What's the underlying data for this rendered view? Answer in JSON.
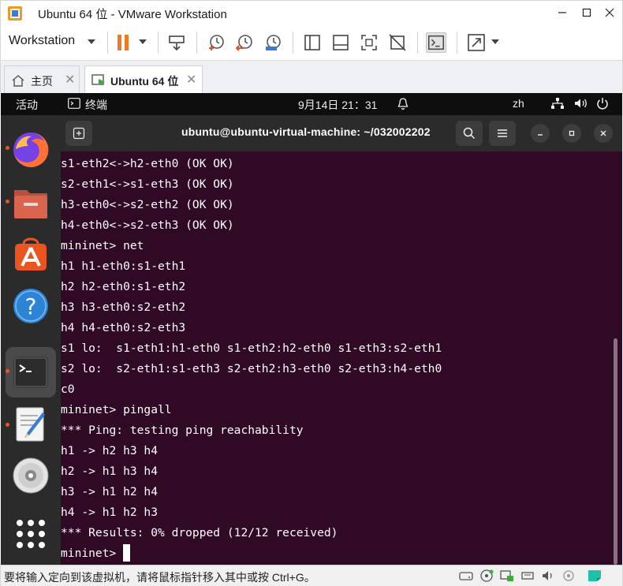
{
  "window": {
    "title": "Ubuntu 64 位 - VMware Workstation",
    "minimize": "—",
    "maximize": "☐",
    "close": "✕"
  },
  "toolbar": {
    "menu_label": "Workstation"
  },
  "tabs": [
    {
      "label": "主页",
      "icon": "home-icon"
    },
    {
      "label": "Ubuntu 64 位",
      "icon": "vm-running-icon"
    }
  ],
  "gnome_bar": {
    "activities": "活动",
    "app_name": "终端",
    "datetime": "9月14日  21：31",
    "input_method": "zh"
  },
  "dock": {
    "items": [
      "firefox-icon",
      "files-icon",
      "app-center-icon",
      "help-icon",
      "terminal-icon",
      "text-editor-icon",
      "disc-icon",
      "show-apps-icon"
    ]
  },
  "terminal": {
    "title": "ubuntu@ubuntu-virtual-machine: ~/032002202",
    "lines": [
      "s1-eth2<->h2-eth0 (OK OK)",
      "s2-eth1<->s1-eth3 (OK OK)",
      "h3-eth0<->s2-eth2 (OK OK)",
      "h4-eth0<->s2-eth3 (OK OK)",
      "mininet> net",
      "h1 h1-eth0:s1-eth1",
      "h2 h2-eth0:s1-eth2",
      "h3 h3-eth0:s2-eth2",
      "h4 h4-eth0:s2-eth3",
      "s1 lo:  s1-eth1:h1-eth0 s1-eth2:h2-eth0 s1-eth3:s2-eth1",
      "s2 lo:  s2-eth1:s1-eth3 s2-eth2:h3-eth0 s2-eth3:h4-eth0",
      "c0",
      "mininet> pingall",
      "*** Ping: testing ping reachability",
      "h1 -> h2 h3 h4",
      "h2 -> h1 h3 h4",
      "h3 -> h1 h2 h4",
      "h4 -> h1 h2 h3",
      "*** Results: 0% dropped (12/12 received)"
    ],
    "prompt": "mininet> "
  },
  "statusbar": {
    "message": "要将输入定向到该虚拟机，请将鼠标指针移入其中或按 Ctrl+G。"
  },
  "colors": {
    "terminal_bg": "#300a24",
    "ubuntu_orange": "#e95420",
    "pause_orange": "#f07a22"
  }
}
